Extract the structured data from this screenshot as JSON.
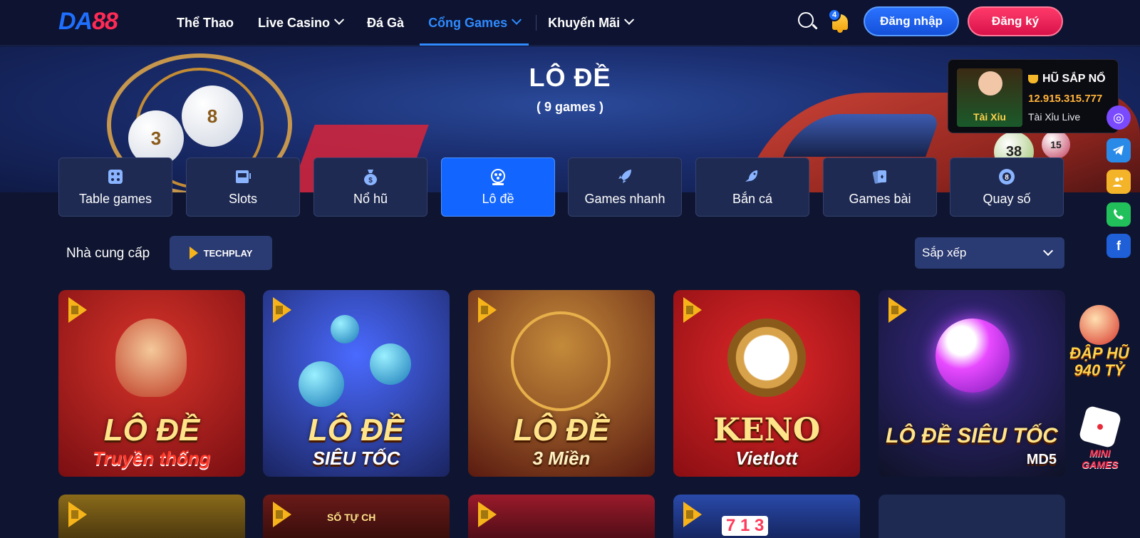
{
  "header": {
    "logo_da": "DA",
    "logo_88": "88",
    "nav": [
      {
        "label": "Thể Thao",
        "dropdown": false,
        "active": false
      },
      {
        "label": "Live Casino",
        "dropdown": true,
        "active": false
      },
      {
        "label": "Đá Gà",
        "dropdown": false,
        "active": false
      },
      {
        "label": "Cổng Games",
        "dropdown": true,
        "active": true
      },
      {
        "label": "Khuyến Mãi",
        "dropdown": true,
        "active": false
      }
    ],
    "notification_count": "4",
    "login_label": "Đăng nhập",
    "register_label": "Đăng ký"
  },
  "banner": {
    "title": "LÔ ĐỀ",
    "count": "( 9 games )",
    "balls": [
      "3",
      "8",
      "38",
      "15"
    ]
  },
  "jackpot": {
    "title": "HŨ SẮP NỔ",
    "amount": "12.915.315.777",
    "game": "Tài Xỉu Live",
    "thumb_label": "Tài Xỉu"
  },
  "categories": [
    {
      "label": "Table games",
      "icon": "dice-icon",
      "active": false
    },
    {
      "label": "Slots",
      "icon": "slot-machine-icon",
      "active": false
    },
    {
      "label": "Nổ hũ",
      "icon": "money-bag-icon",
      "active": false
    },
    {
      "label": "Lô đề",
      "icon": "lottery-wheel-icon",
      "active": true
    },
    {
      "label": "Games nhanh",
      "icon": "rocket-icon",
      "active": false
    },
    {
      "label": "Bắn cá",
      "icon": "fish-icon",
      "active": false
    },
    {
      "label": "Games bài",
      "icon": "cards-icon",
      "active": false
    },
    {
      "label": "Quay số",
      "icon": "ball-8-icon",
      "active": false
    }
  ],
  "provider": {
    "label": "Nhà cung cấp",
    "selected": "TECHPLAY"
  },
  "sort": {
    "label": "Sắp xếp"
  },
  "games": [
    {
      "line1": "LÔ ĐỀ",
      "line2": "Truyền thống",
      "bg": "#9a1418"
    },
    {
      "line1": "LÔ ĐỀ",
      "line2": "SIÊU TỐC",
      "bg": "#2a3a9a"
    },
    {
      "line1": "LÔ ĐỀ",
      "line2": "3 Miền",
      "bg": "#7a2a18"
    },
    {
      "line1": "KENO",
      "line2": "Vietlott",
      "bg": "#b0161a"
    },
    {
      "line1": "LÔ ĐỀ SIÊU TỐC",
      "line2": "MD5",
      "bg": "#1a2a4a"
    }
  ],
  "games_row2": [
    {
      "bg": "#6a4a10",
      "partial_text": ""
    },
    {
      "bg": "#5a1a14",
      "partial_text": "SỐ TỰ CH"
    },
    {
      "bg": "#7a1622",
      "partial_text": ""
    },
    {
      "bg": "#1a3a8a",
      "partial_text": "7 1 3"
    },
    {
      "bg": "#1e2a52",
      "partial_text": ""
    }
  ],
  "side_icons": [
    "chat-icon",
    "telegram-icon",
    "contacts-icon",
    "phone-icon",
    "facebook-icon"
  ],
  "floating": {
    "jackpot_promo": "ĐẬP HŨ",
    "jackpot_promo_amount": "940 TỶ",
    "mini_games": "MINI GAMES"
  },
  "colors": {
    "accent": "#1266ff",
    "brand_blue": "#1f6fff",
    "brand_red": "#ff2a55",
    "background": "#0f1530"
  }
}
